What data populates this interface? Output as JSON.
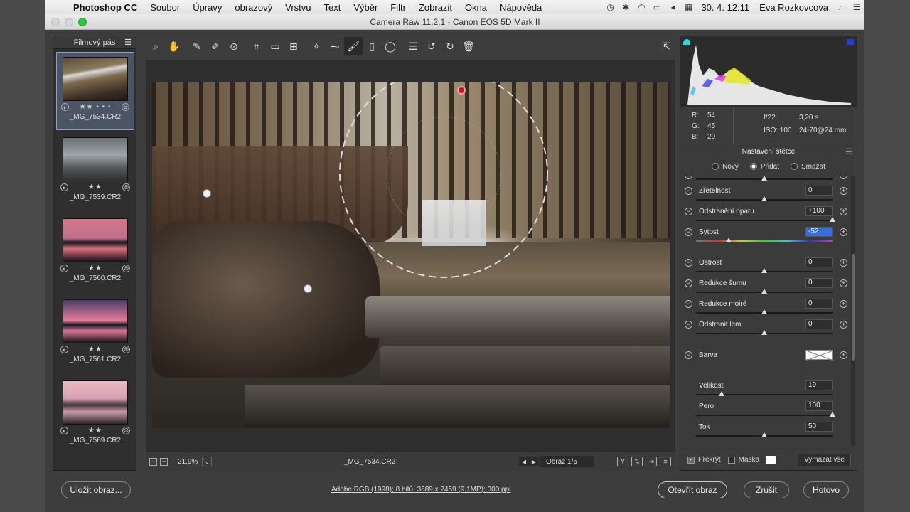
{
  "menubar": {
    "app": "Photoshop CC",
    "items": [
      "Soubor",
      "Úpravy",
      "obrazový",
      "Vrstvu",
      "Text",
      "Výběr",
      "Filtr",
      "Zobrazit",
      "Okna",
      "Nápověda"
    ],
    "datetime": "30. 4.  12:11",
    "user": "Eva Rozkovcova"
  },
  "window": {
    "title": "Camera Raw 11.2.1  -  Canon EOS 5D Mark II"
  },
  "filmstrip": {
    "title": "Filmový pás",
    "items": [
      {
        "name": "_MG_7534.CR2",
        "stars": "★★ • • •"
      },
      {
        "name": "_MG_7539.CR2",
        "stars": "★★"
      },
      {
        "name": "_MG_7560.CR2",
        "stars": "★★"
      },
      {
        "name": "_MG_7561.CR2",
        "stars": "★★"
      },
      {
        "name": "_MG_7569.CR2",
        "stars": "★★"
      }
    ]
  },
  "canvas": {
    "zoom": "21,9%",
    "filename": "_MG_7534.CR2",
    "page": "Obraz 1/5"
  },
  "info": {
    "r_label": "R:",
    "r": "54",
    "g_label": "G:",
    "g": "45",
    "b_label": "B:",
    "b": "20",
    "aperture": "f/22",
    "shutter": "3,20 s",
    "iso": "ISO: 100",
    "lens": "24-70@24 mm"
  },
  "brush": {
    "title": "Nastavení štětce",
    "modes": [
      "Nový",
      "Přidat",
      "Smazat"
    ],
    "selected_mode": "Přidat",
    "sliders": [
      {
        "label": "Zřetelnost",
        "value": "0",
        "pos": 0.5
      },
      {
        "label": "Odstranění oparu",
        "value": "+100",
        "pos": 1.0
      },
      {
        "label": "Sytost",
        "value": "-52",
        "pos": 0.24
      },
      {
        "label": "Ostrost",
        "value": "0",
        "pos": 0.5
      },
      {
        "label": "Redukce šumu",
        "value": "0",
        "pos": 0.5
      },
      {
        "label": "Redukce moiré",
        "value": "0",
        "pos": 0.5
      },
      {
        "label": "Odstranit lem",
        "value": "0",
        "pos": 0.5
      }
    ],
    "color_label": "Barva",
    "size_label": "Velikost",
    "size": "19",
    "size_pos": 0.19,
    "feather_label": "Pero",
    "feather": "100",
    "feather_pos": 1.0,
    "flow_label": "Tok",
    "flow": "50",
    "flow_pos": 0.5,
    "overlay_label": "Překrýt",
    "mask_label": "Maska",
    "clear_all": "Vymazat vše"
  },
  "bottom": {
    "save": "Uložit obraz...",
    "workflow": "Adobe RGB (1998); 8 bitů; 3689 x 2459 (9,1MP); 300 ppi",
    "open": "Otevřít obraz",
    "cancel": "Zrušit",
    "done": "Hotovo"
  }
}
